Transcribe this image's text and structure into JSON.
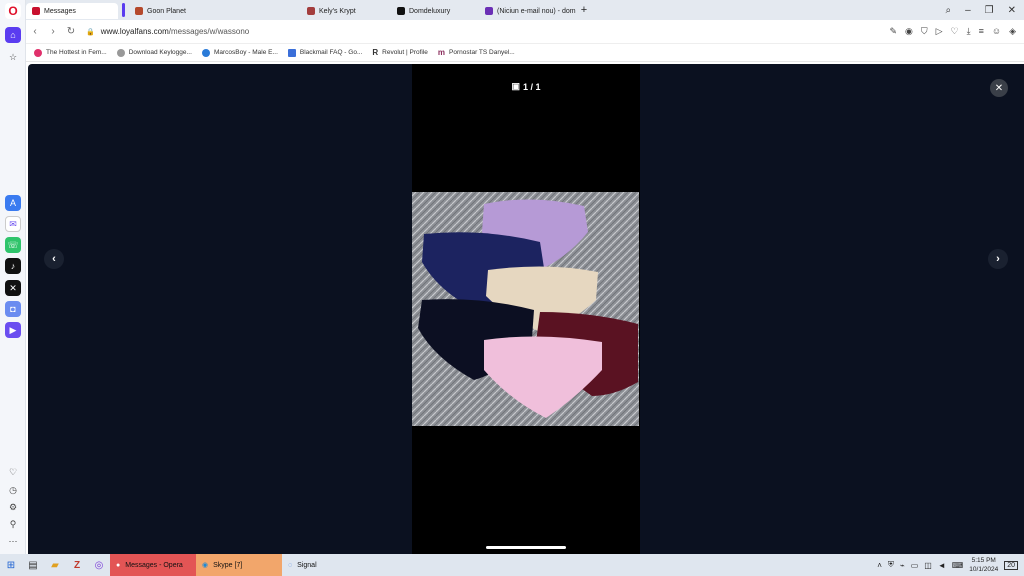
{
  "browser": {
    "tabs": [
      {
        "label": "Messages",
        "active": true,
        "color": "#c8102e"
      },
      {
        "label": "Goon Planet",
        "active": false,
        "color": "#b5492c"
      },
      {
        "label": "Kely's Krypt",
        "active": false,
        "color": "#a33d3d"
      },
      {
        "label": "Domdeluxury",
        "active": false,
        "color": "#111111"
      },
      {
        "label": "(Niciun e-mail nou) - dom",
        "active": false,
        "color": "#6b2fb5"
      }
    ],
    "url_host": "www.loyalfans.com",
    "url_path": "/messages/w/wassono",
    "bookmarks": [
      {
        "label": "The Hottest in Fem...",
        "color": "#e0306b"
      },
      {
        "label": "Download Keylogge...",
        "color": "#999999"
      },
      {
        "label": "MarcosBoy - Male E...",
        "color": "#2a7bd8"
      },
      {
        "label": "Blackmail FAQ - Go...",
        "color": "#3b6fd9"
      },
      {
        "label": "Revolut | Profile",
        "color": "#111111"
      },
      {
        "label": "Pornostar TS Danyel...",
        "color": "#8a2d5c"
      }
    ]
  },
  "viewer": {
    "counter": "1 / 1",
    "accent_color": "#5a3cf0"
  },
  "taskbar": {
    "apps": [
      {
        "label": "Messages - Opera",
        "color": "#e35555"
      },
      {
        "label": "Skype [7]",
        "color": "#f2a66b"
      },
      {
        "label": "Signal",
        "color": "#dfe6ef"
      }
    ],
    "time": "5:15 PM",
    "date": "10/1/2024",
    "notif_count": "20"
  }
}
